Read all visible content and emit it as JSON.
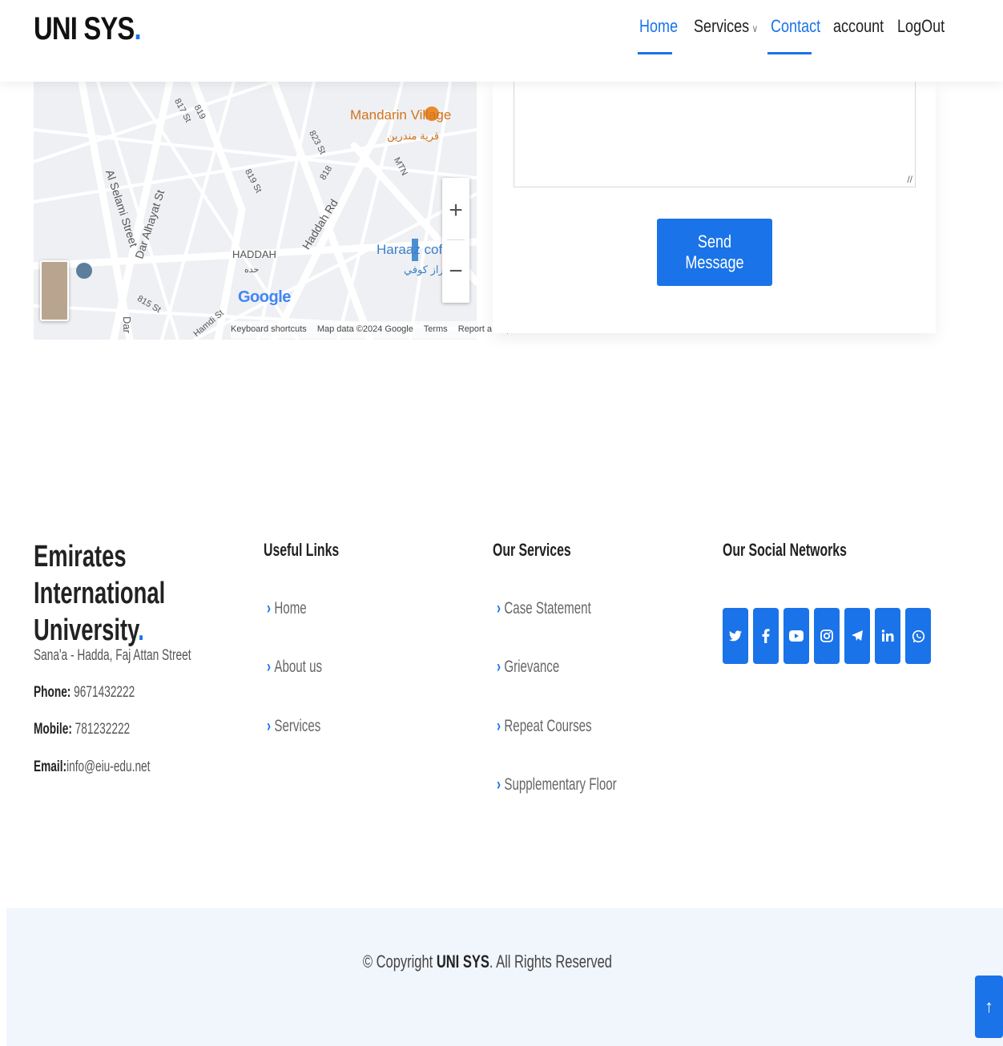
{
  "header": {
    "logo_text": "UNI SYS",
    "logo_dot": ".",
    "nav": [
      {
        "label": "Home",
        "active": true
      },
      {
        "label": "Services",
        "has_dropdown": true
      },
      {
        "label": "Contact",
        "active": true
      },
      {
        "label": "account"
      },
      {
        "label": "LogOut"
      }
    ],
    "dropdown_glyph": "∨"
  },
  "map": {
    "labels": {
      "mandarin": "Mandarin Village",
      "mandarin_ar": "قرية مندرين",
      "haddah": "HADDAH",
      "haddah_ar": "حده",
      "haraaz": "Haraaz coffee",
      "haraaz_ar": "حراز كوفي",
      "selami": "Al Selami Street",
      "alhayat": "Dar Alhayat St",
      "haddah_rd": "Haddah Rd",
      "mtn": "MTN",
      "s817": "817 St",
      "s819": "819",
      "s823": "823 St",
      "s819b": "819 St",
      "s818": "818",
      "s815": "815 St",
      "hamdi": "Hamdi St",
      "dar": "Dar"
    },
    "google_logo": "Google",
    "zoom_in": "+",
    "zoom_out": "−",
    "footer": {
      "shortcuts": "Keyboard shortcuts",
      "mapdata": "Map data ©2024 Google",
      "terms": "Terms",
      "report": "Report a map error"
    }
  },
  "form": {
    "send_label": "Send Message"
  },
  "footer": {
    "title_line1": "Emirates International",
    "title_line2": "University",
    "title_dot": ".",
    "address": "Sana'a - Hadda, Faj Attan Street",
    "phone_label": "Phone:",
    "phone": "9671432222",
    "mobile_label": "Mobile:",
    "mobile": "781232222",
    "email_label": "Email:",
    "email": "info@eiu-edu.net",
    "useful_links": {
      "heading": "Useful Links",
      "items": [
        "Home",
        "About us",
        "Services"
      ]
    },
    "our_services": {
      "heading": "Our Services",
      "items": [
        "Case Statement",
        "Grievance",
        "Repeat Courses",
        "Supplementary Floor"
      ]
    },
    "social": {
      "heading": "Our Social Networks",
      "icons": [
        "twitter-icon",
        "facebook-icon",
        "youtube-icon",
        "instagram-icon",
        "telegram-icon",
        "linkedin-icon",
        "whatsapp-icon"
      ]
    },
    "arrow_glyph": "›"
  },
  "copyright": {
    "prefix": "© Copyright",
    "brand": "UNI SYS",
    "suffix": ". All Rights Reserved"
  },
  "back_to_top_glyph": "↑",
  "colors": {
    "accent": "#1a73e8",
    "text_dark": "#222222",
    "copy_bar_bg": "#f1f5fc"
  }
}
